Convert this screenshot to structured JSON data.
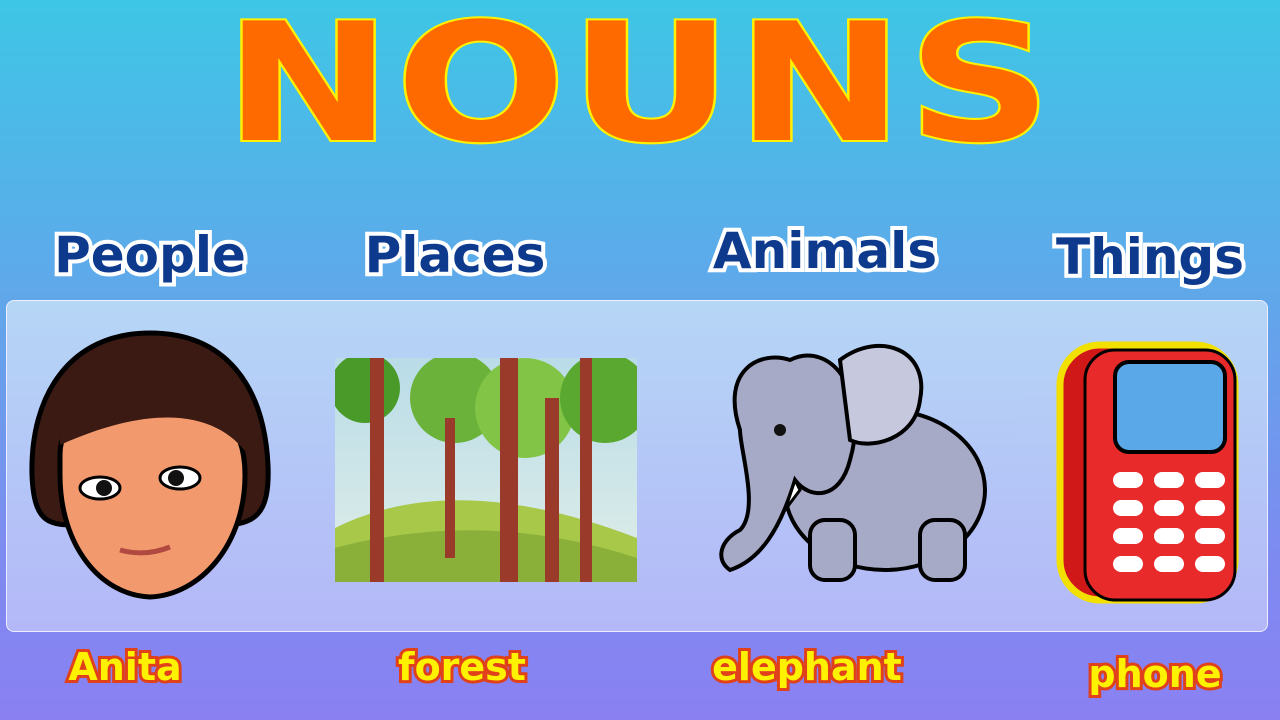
{
  "title": "NOUNS",
  "categories": [
    {
      "label": "People",
      "example": "Anita",
      "icon": "woman-face"
    },
    {
      "label": "Places",
      "example": "forest",
      "icon": "forest-scene"
    },
    {
      "label": "Animals",
      "example": "elephant",
      "icon": "elephant"
    },
    {
      "label": "Things",
      "example": "phone",
      "icon": "mobile-phone"
    }
  ],
  "colors": {
    "title": "#ff6a00",
    "title_outline": "#fff200",
    "category": "#0e3a8e",
    "example": "#fff200"
  }
}
